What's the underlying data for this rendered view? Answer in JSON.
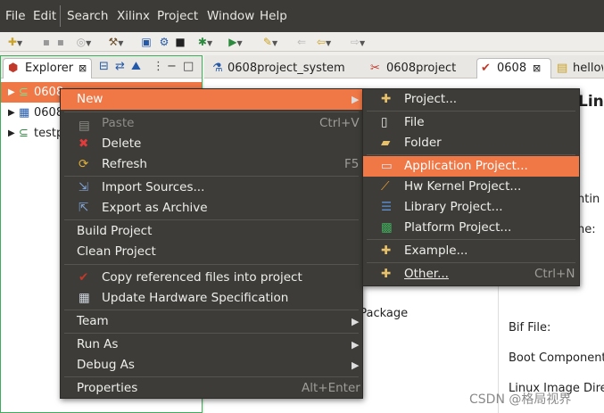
{
  "menubar": {
    "items": [
      "File",
      "Edit",
      "Search",
      "Xilinx",
      "Project",
      "Window",
      "Help"
    ]
  },
  "explorer": {
    "tab_label": "Explorer",
    "rows": [
      "0608",
      "0608",
      "testp"
    ]
  },
  "editor": {
    "tabs": [
      "0608project_system",
      "0608project",
      "0608",
      "hellow"
    ],
    "partial_title": "Linu",
    "partial_labels": [
      "ntin",
      "ne:",
      "t Package",
      "Bif File:",
      "Boot Component",
      "Linux Image Dire"
    ]
  },
  "context_menu": {
    "items": [
      {
        "label": "New",
        "shortcut": ""
      },
      {
        "label": "Paste",
        "shortcut": "Ctrl+V"
      },
      {
        "label": "Delete",
        "shortcut": ""
      },
      {
        "label": "Refresh",
        "shortcut": "F5"
      },
      {
        "label": "Import Sources...",
        "shortcut": ""
      },
      {
        "label": "Export as Archive",
        "shortcut": ""
      },
      {
        "label": "Build Project",
        "shortcut": ""
      },
      {
        "label": "Clean Project",
        "shortcut": ""
      },
      {
        "label": "Copy referenced files into project",
        "shortcut": ""
      },
      {
        "label": "Update Hardware Specification",
        "shortcut": ""
      },
      {
        "label": "Team",
        "shortcut": ""
      },
      {
        "label": "Run As",
        "shortcut": ""
      },
      {
        "label": "Debug As",
        "shortcut": ""
      },
      {
        "label": "Properties",
        "shortcut": "Alt+Enter"
      }
    ]
  },
  "submenu": {
    "items": [
      {
        "label": "Project...",
        "shortcut": ""
      },
      {
        "label": "File",
        "shortcut": ""
      },
      {
        "label": "Folder",
        "shortcut": ""
      },
      {
        "label": "Application Project...",
        "shortcut": ""
      },
      {
        "label": "Hw Kernel Project...",
        "shortcut": ""
      },
      {
        "label": "Library Project...",
        "shortcut": ""
      },
      {
        "label": "Platform Project...",
        "shortcut": ""
      },
      {
        "label": "Example...",
        "shortcut": ""
      },
      {
        "label": "Other...",
        "shortcut": "Ctrl+N"
      }
    ]
  },
  "watermark": "CSDN @格局视界",
  "colors": {
    "highlight": "#f07746",
    "menu_bg": "#3d3c38",
    "menubar_bg": "#3c3b37",
    "explorer_border": "#3fae5c"
  }
}
